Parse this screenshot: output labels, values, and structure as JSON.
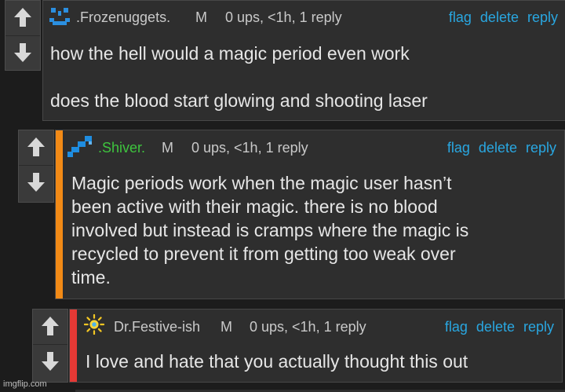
{
  "comments": [
    {
      "username": ".Frozenuggets.",
      "mod_badge": "M",
      "stats": "0 ups, <1h, 1 reply",
      "actions": {
        "flag": "flag",
        "delete": "delete",
        "reply": "reply"
      },
      "text": "how the hell would a magic period even work\n\ndoes the blood start glowing and shooting laser",
      "avatar_icon": "blue-smiley-icon",
      "username_color": "#c9c9c9"
    },
    {
      "username": ".Shiver.",
      "mod_badge": "M",
      "stats": "0 ups, <1h, 1 reply",
      "actions": {
        "flag": "flag",
        "delete": "delete",
        "reply": "reply"
      },
      "text": "Magic periods work when the magic user hasn’t\nbeen active with their magic. there is no blood\ninvolved but instead is cramps where the magic is\nrecycled to prevent it from getting too weak over\ntime.",
      "avatar_icon": "blue-staircase-icon",
      "username_color": "#3ec43e",
      "accent_color": "#f28a16"
    },
    {
      "username": "Dr.Festive-ish",
      "mod_badge": "M",
      "stats": "0 ups, <1h, 1 reply",
      "actions": {
        "flag": "flag",
        "delete": "delete",
        "reply": "reply"
      },
      "text": "I love and hate that you actually thought this out",
      "avatar_icon": "sun-icon",
      "username_color": "#c9c9c9",
      "accent_color": "#e53935"
    }
  ],
  "watermark": "imgflip.com"
}
